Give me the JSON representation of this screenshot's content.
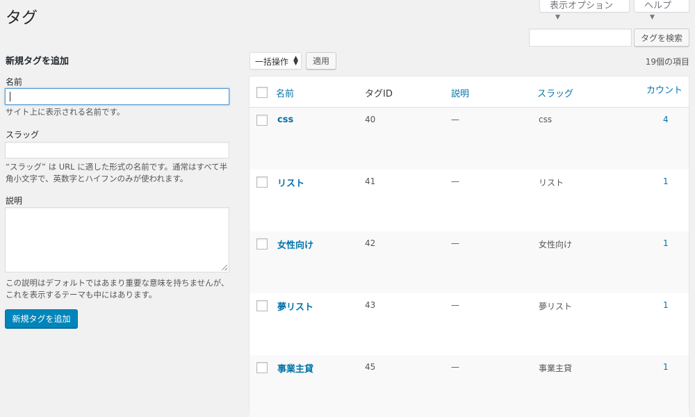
{
  "page": {
    "title": "タグ"
  },
  "top_buttons": {
    "screen_options": "表示オプション",
    "help": "ヘルプ"
  },
  "search": {
    "button": "タグを検索",
    "value": ""
  },
  "form": {
    "heading": "新規タグを追加",
    "name_label": "名前",
    "name_value": "",
    "name_help": "サイト上に表示される名前です。",
    "slug_label": "スラッグ",
    "slug_value": "",
    "slug_help_1": "“スラッグ” は URL に適した形式の名前です。通常はすべて半",
    "slug_help_2": "角小文字で、英数字とハイフンのみが使われます。",
    "desc_label": "説明",
    "desc_value": "",
    "desc_help_1": "この説明はデフォルトではあまり重要な意味を持ちませんが、",
    "desc_help_2": "これを表示するテーマも中にはあります。",
    "submit": "新規タグを追加"
  },
  "list": {
    "bulk_action": "一括操作",
    "apply": "適用",
    "items_count": "19個の項目",
    "columns": {
      "name": "名前",
      "tag_id": "タグID",
      "description": "説明",
      "slug": "スラッグ",
      "count": "カウント"
    },
    "rows": [
      {
        "name": "css",
        "id": "40",
        "description": "—",
        "slug": "css",
        "count": "4"
      },
      {
        "name": "リスト",
        "id": "41",
        "description": "—",
        "slug": "リスト",
        "count": "1"
      },
      {
        "name": "女性向け",
        "id": "42",
        "description": "—",
        "slug": "女性向け",
        "count": "1"
      },
      {
        "name": "夢リスト",
        "id": "43",
        "description": "—",
        "slug": "夢リスト",
        "count": "1"
      },
      {
        "name": "事業主貸",
        "id": "45",
        "description": "—",
        "slug": "事業主貸",
        "count": "1"
      }
    ]
  },
  "colors": {
    "link": "#0073aa",
    "primary": "#0085ba",
    "background": "#f1f1f1"
  }
}
